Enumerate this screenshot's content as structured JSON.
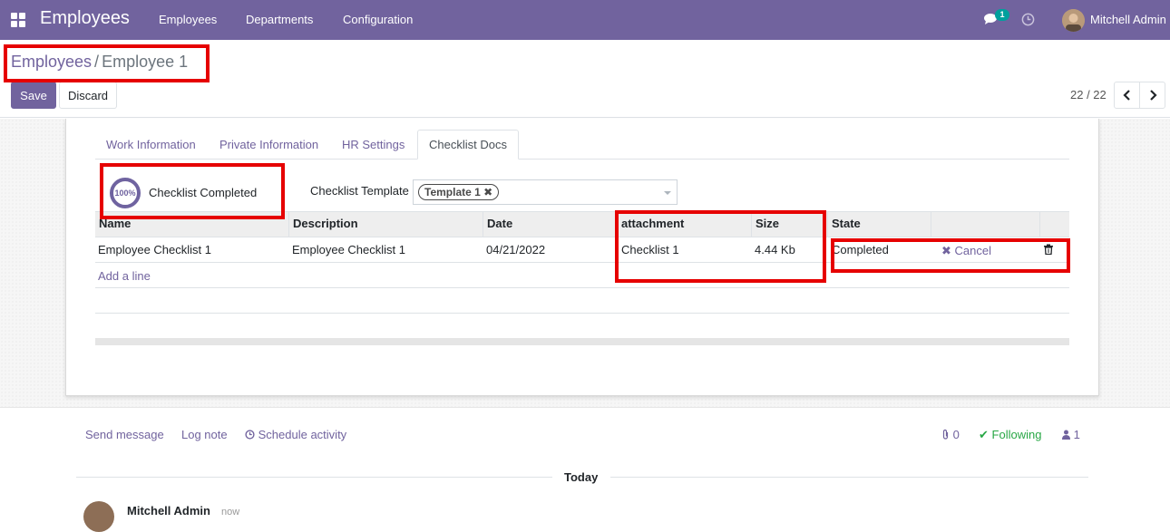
{
  "navbar": {
    "app_title": "Employees",
    "menu": [
      "Employees",
      "Departments",
      "Configuration"
    ],
    "message_count": "1",
    "user_name": "Mitchell Admin",
    "bg_color": "#71639e"
  },
  "breadcrumb": {
    "parent": "Employees",
    "separator": "/",
    "current": "Employee 1"
  },
  "buttons": {
    "save": "Save",
    "discard": "Discard"
  },
  "pager": {
    "value": "22 / 22"
  },
  "tabs": [
    {
      "label": "Work Information",
      "active": false
    },
    {
      "label": "Private Information",
      "active": false
    },
    {
      "label": "HR Settings",
      "active": false
    },
    {
      "label": "Checklist Docs",
      "active": true
    }
  ],
  "progress": {
    "percent": "100%",
    "label": "Checklist Completed"
  },
  "template": {
    "label": "Checklist Template",
    "tag": "Template 1"
  },
  "table": {
    "headers": [
      "Name",
      "Description",
      "Date",
      "attachment",
      "Size",
      "State"
    ],
    "rows": [
      {
        "name": "Employee Checklist 1",
        "description": "Employee Checklist 1",
        "date": "04/21/2022",
        "attachment": "Checklist 1",
        "size": "4.44 Kb",
        "state": "Completed",
        "action": "Cancel"
      }
    ],
    "add_line": "Add a line"
  },
  "chatter": {
    "send_message": "Send message",
    "log_note": "Log note",
    "schedule_activity": "Schedule activity",
    "attachments_count": "0",
    "following": "Following",
    "followers_count": "1",
    "date_separator": "Today",
    "message_author": "Mitchell Admin",
    "message_time": "now"
  },
  "colors": {
    "accent": "#71639e",
    "highlight": "#e60000",
    "following": "#28a745"
  }
}
